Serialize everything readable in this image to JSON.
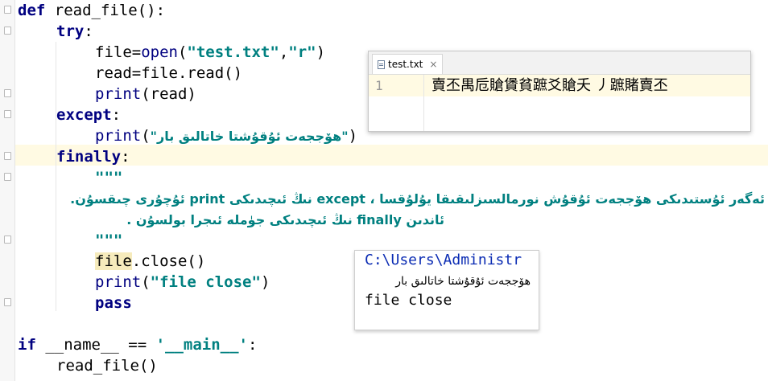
{
  "code": {
    "l1_def": "def",
    "l1_rest": " read_file():",
    "l2_try": "try",
    "l2_colon": ":",
    "l3_a": "file=",
    "l3_open": "open",
    "l3_b": "(",
    "l3_s1": "\"test.txt\"",
    "l3_c": ",",
    "l3_s2": "\"r\"",
    "l3_d": ")",
    "l4_a": "read=file.read()",
    "l5_print": "print",
    "l5_rest": "(read)",
    "l6_except": "except",
    "l6_colon": ":",
    "l7_print": "print",
    "l7_open": "(",
    "l7_str": "\"ھۆججەت ئۇقۇشتا خاتالىق بار\"",
    "l7_close": ")",
    "l8_finally": "finally",
    "l8_colon": ":",
    "l9_doc": "\"\"\"",
    "l10_doc": "ئەگەر ئۇستىدىكى ھۆججەت ئۇقۇش نورمالسىزلىقىقا يۇلۇقسا ، except نىڭ ئىچىدىكى print ئۇچۇرى چىقسۇن.",
    "l11_doc": "ئاندىن finally نىڭ ئىچىدىكى جۈملە ئىجرا بولسۇن .",
    "l12_doc": "\"\"\"",
    "l13_file": "file",
    "l13_rest": ".close()",
    "l14_print": "print",
    "l14_open": "(",
    "l14_str": "\"file close\"",
    "l14_close": ")",
    "l15_pass": "pass",
    "l17_if": "if",
    "l17_a": " __name__ == ",
    "l17_str": "'__main__'",
    "l17_colon": ":",
    "l18_call": "read_file()"
  },
  "file_popup": {
    "tab_label": "test.txt",
    "close_glyph": "×",
    "line_number": "1",
    "content": "賣丕禺卮賶賲貧蹠爻賶夭 丿蹠賭賣丕"
  },
  "console_popup": {
    "path": "C:\\Users\\Administr",
    "line1": "ھۆججەت ئۇقۇشتا خاتالىق بار",
    "line2": "file close"
  }
}
